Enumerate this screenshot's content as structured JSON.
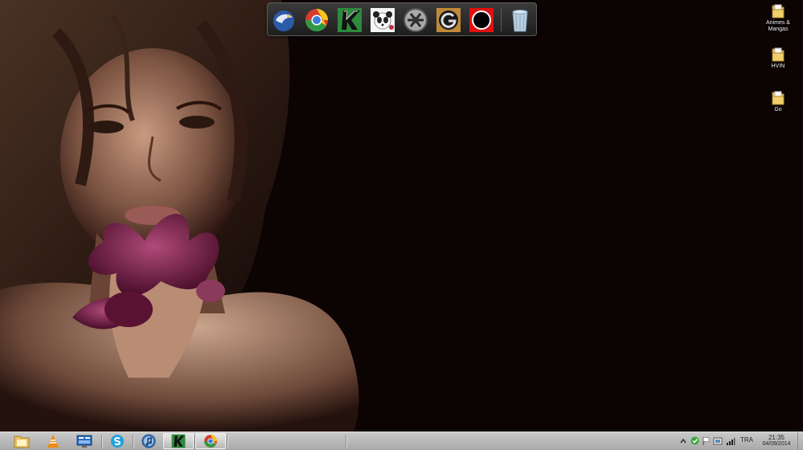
{
  "desktop": {
    "icons": [
      {
        "label": "Animes & Mangas",
        "icon": "folder-icon"
      },
      {
        "label": "HVIN",
        "icon": "folder-icon"
      },
      {
        "label": "Go",
        "icon": "folder-icon"
      }
    ]
  },
  "dock": {
    "icons": [
      "thunderbird-icon",
      "chrome-icon",
      "k-app-icon",
      "panda-icon",
      "gear-app-icon",
      "g-app-icon",
      "red-ring-icon",
      "recycle-bin-icon"
    ]
  },
  "taskbar": {
    "buttons": [
      "file-explorer-icon",
      "vlc-icon",
      "remote-desktop-icon",
      "skype-icon",
      "itunes-icon",
      "k-app-icon",
      "chrome-icon"
    ],
    "tray": {
      "language": "TRA",
      "time": "21:35",
      "date": "04/09/2014"
    }
  },
  "colors": {
    "background": "#0c0303",
    "taskbar": "#b9b9b9",
    "dock": "#2a2a2a"
  }
}
